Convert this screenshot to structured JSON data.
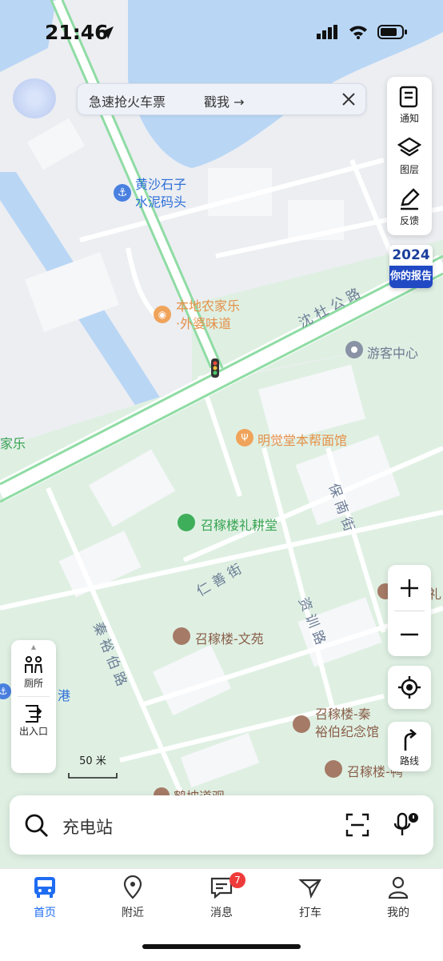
{
  "status_bar": {
    "time": "21:46"
  },
  "banner": {
    "text": "急速抢火车票",
    "link": "戳我 →"
  },
  "tools": [
    {
      "label": "通知",
      "icon": "notice-icon"
    },
    {
      "label": "图层",
      "icon": "layers-icon"
    },
    {
      "label": "反馈",
      "icon": "feedback-icon"
    }
  ],
  "report": {
    "year": "2024",
    "label": "你的报告"
  },
  "map": {
    "pois": [
      {
        "name": "黄沙石子",
        "name2": "水泥码头",
        "icon": "anchor-icon",
        "color": "#2e6fd8"
      },
      {
        "name": "本地农家乐",
        "name2": "·外婆味道",
        "icon": "restaurant-icon",
        "color": "#f0a35a"
      },
      {
        "name": "游客中心",
        "icon": "visitor-center-icon",
        "color": "#7a8496"
      },
      {
        "name": "明觉堂本帮面馆",
        "icon": "noodle-icon",
        "color": "#f0a35a"
      },
      {
        "name": "召稼楼礼耕堂",
        "icon": "park-icon",
        "color": "#3fae5a"
      },
      {
        "name": "召稼楼-文苑",
        "icon": "scenic-icon",
        "color": "#a0705a"
      },
      {
        "name": "召稼楼-秦",
        "name2": "裕伯纪念馆",
        "icon": "museum-icon",
        "color": "#a0705a"
      },
      {
        "name": "召稼楼-鸭",
        "icon": "scenic-icon",
        "color": "#a0705a"
      },
      {
        "name": "家乐",
        "icon": "",
        "color": "#3fae5a"
      },
      {
        "name": "港",
        "icon": "",
        "color": "#2e6fd8"
      },
      {
        "name": "鹤坡道观",
        "icon": "temple-icon",
        "color": "#a0705a"
      },
      {
        "name": "礼",
        "icon": "scenic-icon",
        "color": "#a0705a"
      }
    ],
    "roads": [
      "沈 杜 公 路",
      "仁 善 街",
      "保 南 街",
      "资 训 路",
      "秦 裕 伯 路"
    ],
    "scale_label": "50 米"
  },
  "left_panel": {
    "toilet": "厕所",
    "entrance": "出入口"
  },
  "route_label": "路线",
  "search": {
    "placeholder": "充电站"
  },
  "tabs": [
    {
      "label": "首页",
      "icon": "bus-icon",
      "active": true
    },
    {
      "label": "附近",
      "icon": "location-pin-icon"
    },
    {
      "label": "消息",
      "icon": "message-icon",
      "badge": "7"
    },
    {
      "label": "打车",
      "icon": "taxi-icon"
    },
    {
      "label": "我的",
      "icon": "profile-icon"
    }
  ]
}
